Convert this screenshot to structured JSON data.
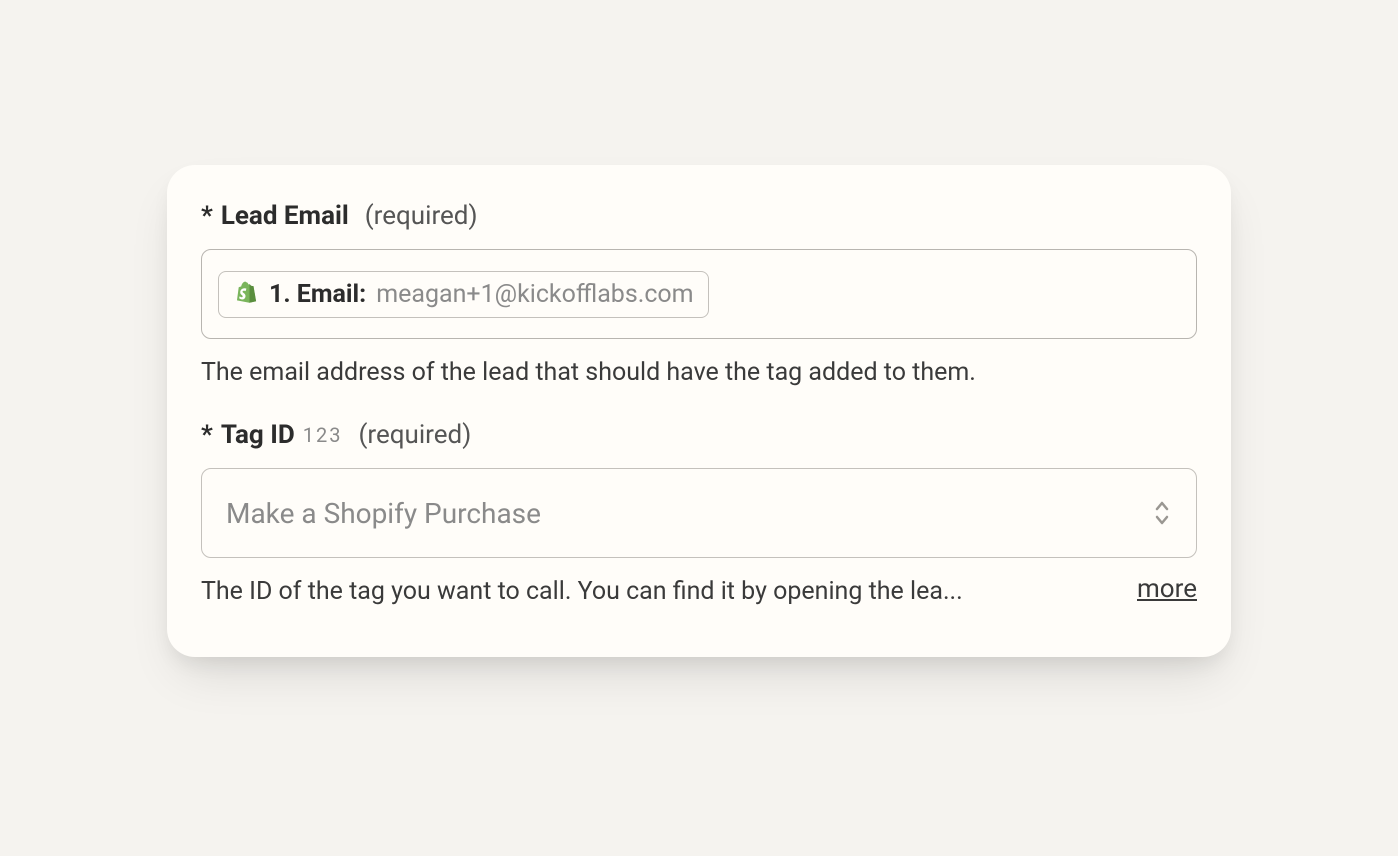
{
  "fields": {
    "lead_email": {
      "asterisk": "*",
      "label": "Lead Email",
      "required": "(required)",
      "pill_label": "1. Email:",
      "pill_value": "meagan+1@kickofflabs.com",
      "help": "The email address of the lead that should have the tag added to them."
    },
    "tag_id": {
      "asterisk": "*",
      "label": "Tag ID",
      "numeric_hint": "123",
      "required": "(required)",
      "selected": "Make a Shopify Purchase",
      "help": "The ID of the tag you want to call. You can find it by opening the lea...",
      "more": "more"
    }
  }
}
